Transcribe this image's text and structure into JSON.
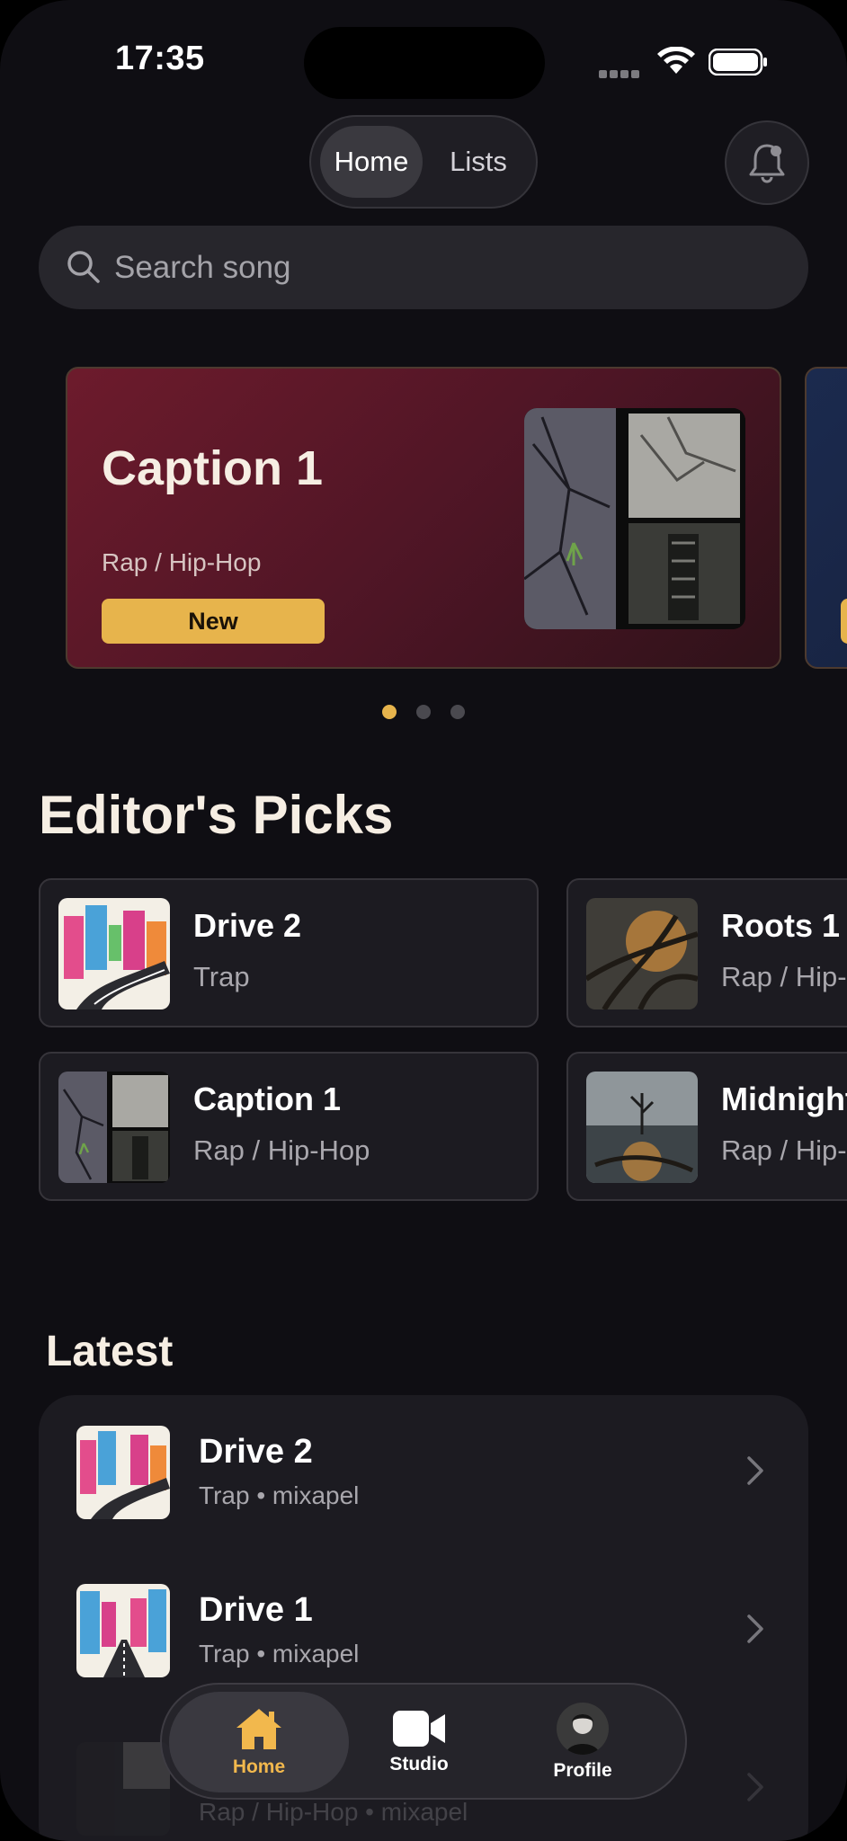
{
  "status_bar": {
    "time": "17:35"
  },
  "top_nav": {
    "tabs": [
      {
        "label": "Home",
        "active": true
      },
      {
        "label": "Lists",
        "active": false
      }
    ],
    "bell_icon": "bell-icon"
  },
  "search": {
    "placeholder": "Search song",
    "value": ""
  },
  "carousel": {
    "cards": [
      {
        "title": "Caption 1",
        "genre": "Rap / Hip-Hop",
        "badge": "New",
        "color": "#6d1b2c"
      },
      {
        "title": "",
        "genre": "",
        "badge": "",
        "color": "#1b2a4e"
      }
    ],
    "page_count": 3,
    "active_index": 0,
    "accent": "#e7b44c"
  },
  "editors_picks": {
    "title": "Editor's Picks",
    "items": [
      {
        "title": "Drive 2",
        "subtitle": "Trap",
        "art": "city-sketch"
      },
      {
        "title": "Roots 1",
        "subtitle": "Rap / Hip-Hop",
        "art": "roots"
      },
      {
        "title": "Caption 1",
        "subtitle": "Rap / Hip-Hop",
        "art": "cracked-collage"
      },
      {
        "title": "Midnight",
        "subtitle": "Rap / Hip-Hop",
        "art": "lone-tree"
      }
    ]
  },
  "latest": {
    "title": "Latest",
    "items": [
      {
        "title": "Drive 2",
        "subtitle": "Trap • mixapel"
      },
      {
        "title": "Drive 1",
        "subtitle": "Trap • mixapel"
      },
      {
        "title": "",
        "subtitle": "Rap / Hip-Hop • mixapel"
      }
    ]
  },
  "tab_bar": {
    "tabs": [
      {
        "label": "Home",
        "icon": "house-icon",
        "active": true
      },
      {
        "label": "Studio",
        "icon": "video-camera-icon",
        "active": false
      },
      {
        "label": "Profile",
        "icon": "avatar",
        "active": false
      }
    ],
    "active_color": "#f2b84d"
  }
}
